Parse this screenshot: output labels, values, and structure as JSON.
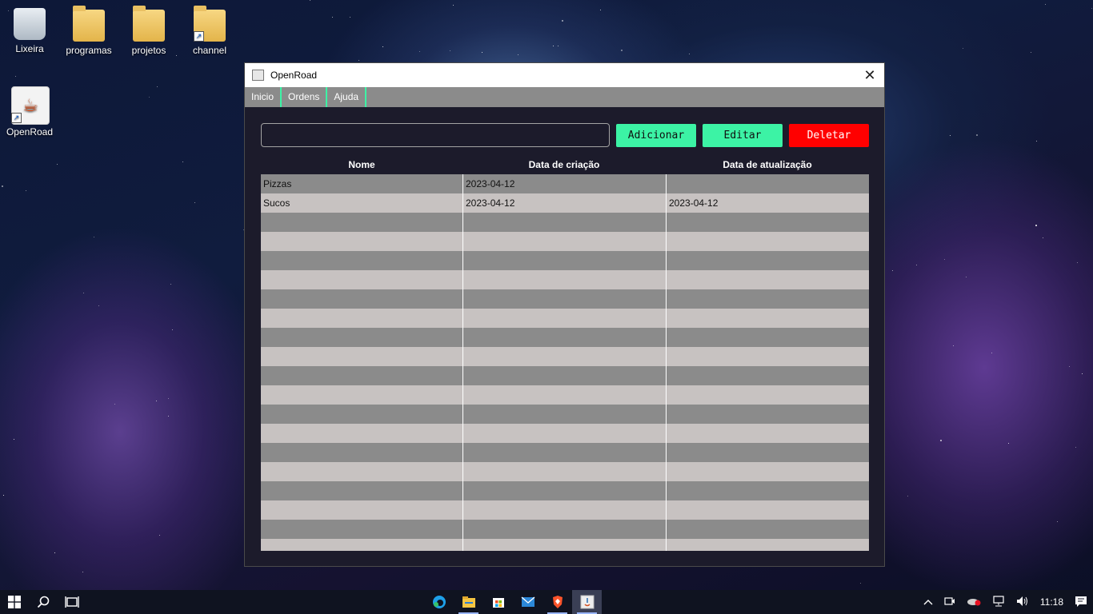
{
  "desktop": {
    "icons": [
      {
        "label": "Lixeira"
      },
      {
        "label": "programas"
      },
      {
        "label": "projetos"
      },
      {
        "label": "channel"
      },
      {
        "label": "OpenRoad"
      }
    ]
  },
  "window": {
    "title": "OpenRoad",
    "close_glyph": "✕",
    "menu": [
      "Inicio",
      "Ordens",
      "Ajuda"
    ],
    "search": {
      "value": "",
      "placeholder": ""
    },
    "buttons": {
      "add": "Adicionar",
      "edit": "Editar",
      "delete": "Deletar"
    },
    "table": {
      "columns": [
        "Nome",
        "Data de criação",
        "Data de atualização"
      ],
      "rows": [
        [
          "Pizzas",
          "2023-04-12",
          ""
        ],
        [
          "Sucos",
          "2023-04-12",
          "2023-04-12"
        ]
      ]
    }
  },
  "taskbar": {
    "clock": "11:18"
  },
  "colors": {
    "accent": "#3cf3a5",
    "danger": "#ff0000",
    "window_bg": "#1c1b2b",
    "row_dark": "#8b8b8b",
    "row_light": "#c7c2c1"
  }
}
